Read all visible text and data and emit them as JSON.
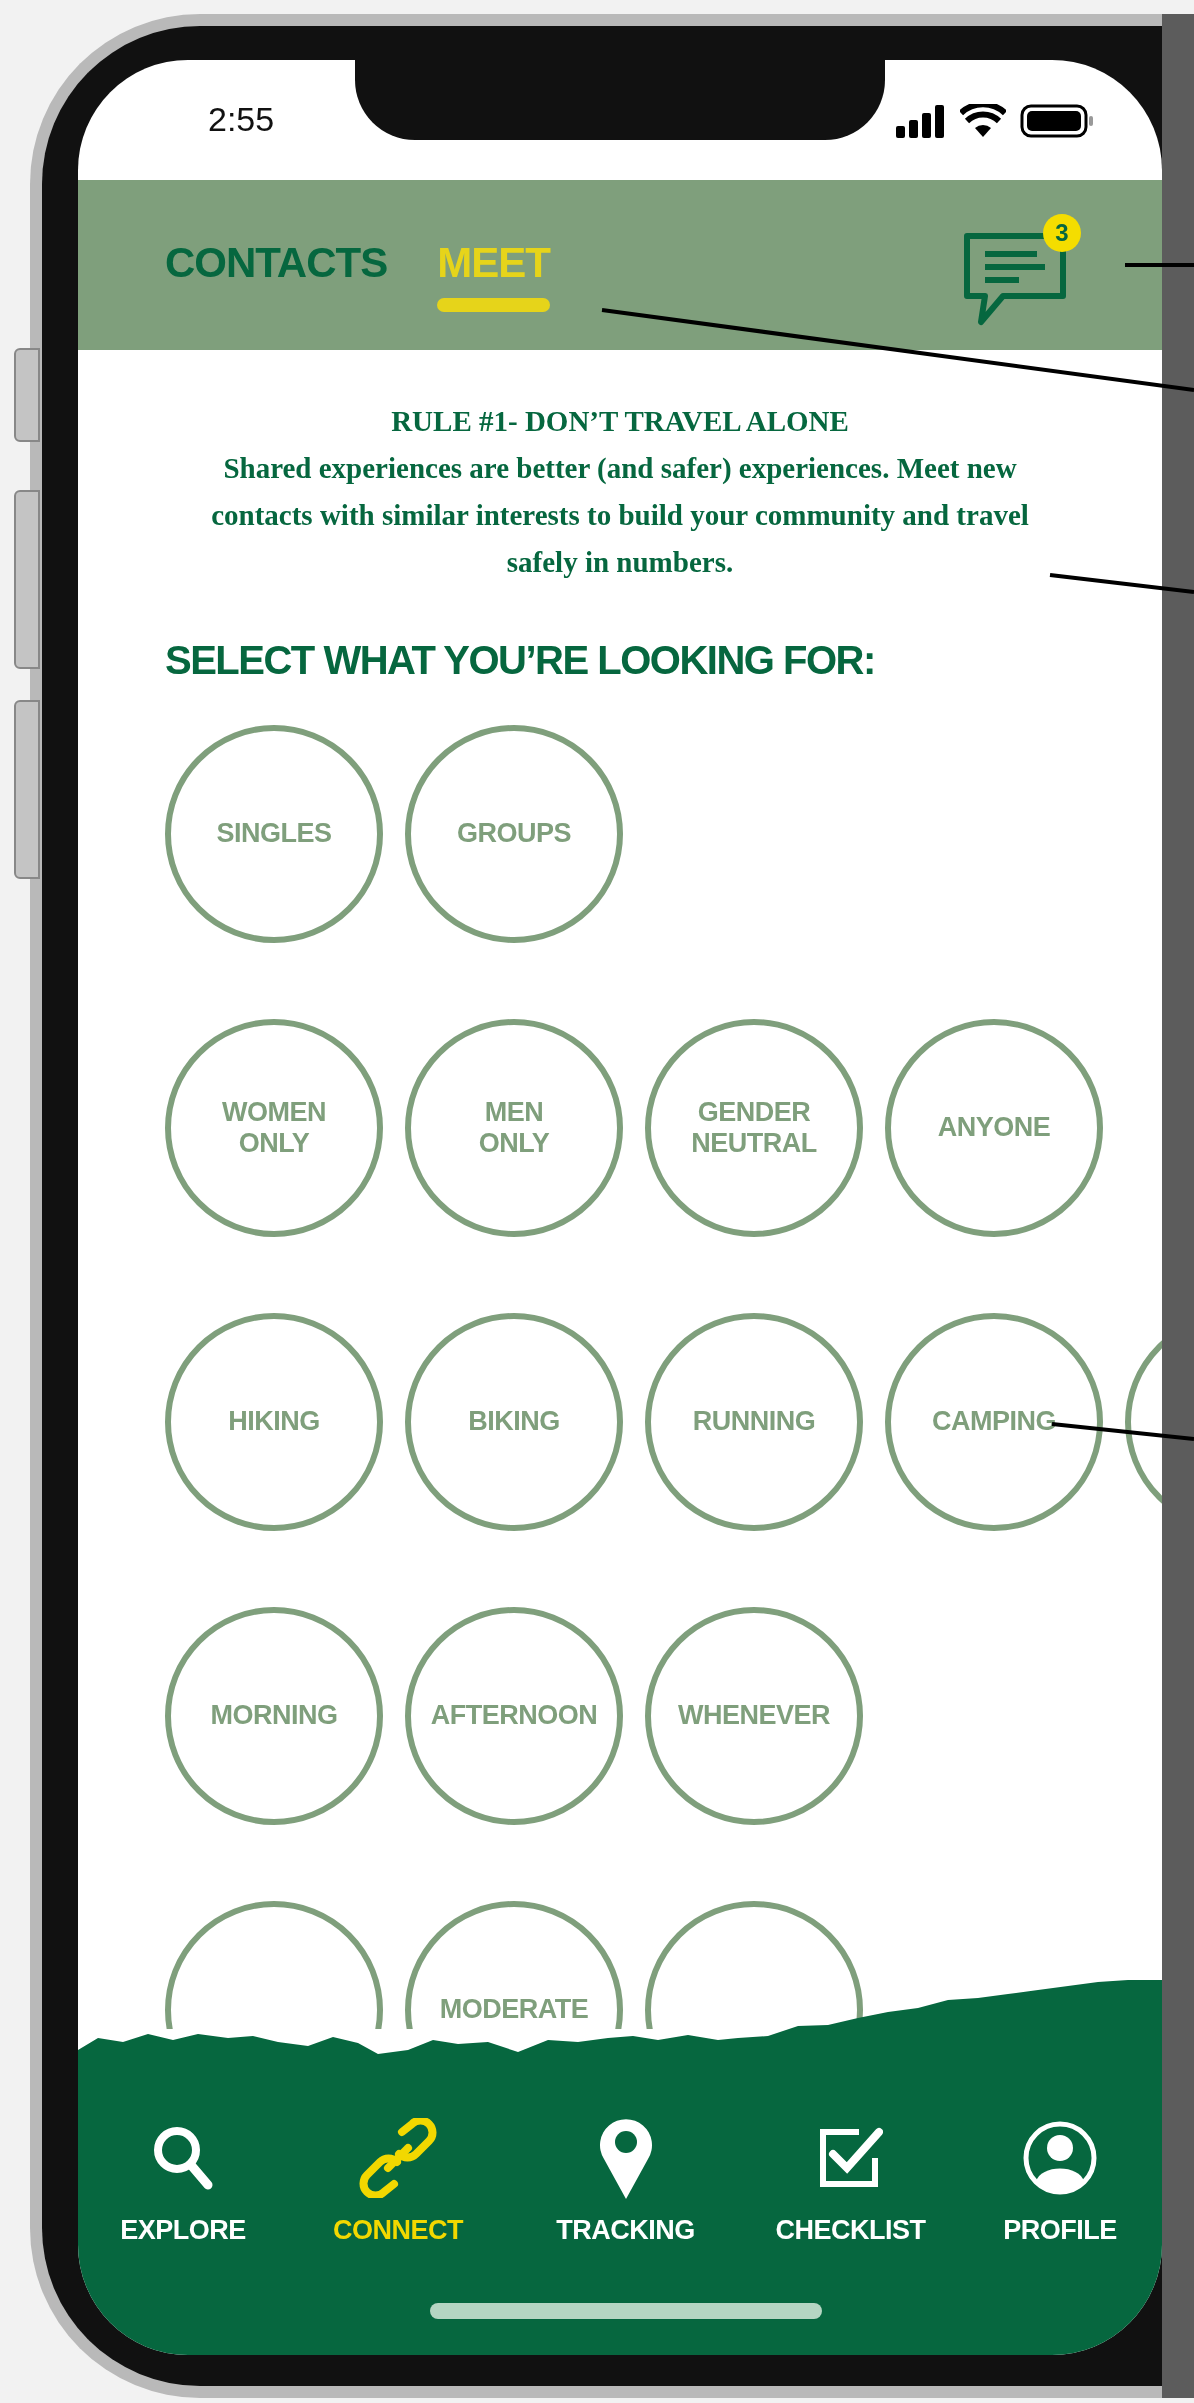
{
  "status_bar": {
    "time": "2:55"
  },
  "tabs": [
    {
      "label": "CONTACTS",
      "selected": false
    },
    {
      "label": "MEET",
      "selected": true
    }
  ],
  "messages": {
    "badge": "3"
  },
  "intro": {
    "title": "RULE #1- DON’T TRAVEL ALONE",
    "text": "Shared experiences are better (and safer) experiences. Meet new contacts with similar interests to build your community and travel safely in numbers."
  },
  "prompt": "SELECT WHAT YOU’RE LOOKING FOR:",
  "option_rows": [
    [
      {
        "label": "SINGLES",
        "selected": false
      },
      {
        "label": "GROUPS",
        "selected": false
      }
    ],
    [
      {
        "label": "WOMEN\nONLY",
        "selected": false
      },
      {
        "label": "MEN\nONLY",
        "selected": false
      },
      {
        "label": "GENDER\nNEUTRAL",
        "selected": false
      },
      {
        "label": "ANYONE",
        "selected": false
      }
    ],
    [
      {
        "label": "HIKING",
        "selected": false
      },
      {
        "label": "BIKING",
        "selected": false
      },
      {
        "label": "RUNNING",
        "selected": false
      },
      {
        "label": "CAMPING",
        "selected": false
      },
      {
        "selected": false
      }
    ],
    [
      {
        "label": "MORNING",
        "selected": false
      },
      {
        "label": "AFTERNOON",
        "selected": false
      },
      {
        "label": "WHENEVER",
        "selected": false
      }
    ],
    [
      {
        "selected": false
      },
      {
        "label": "MODERATE",
        "selected": false
      },
      {
        "selected": false
      }
    ]
  ],
  "nav": [
    {
      "label": "EXPLORE",
      "kind": "search",
      "selected": false
    },
    {
      "label": "CONNECT",
      "kind": "link",
      "selected": true
    },
    {
      "label": "TRACKING",
      "kind": "pin",
      "selected": false
    },
    {
      "label": "CHECKLIST",
      "kind": "checkbox",
      "selected": false
    },
    {
      "label": "PROFILE",
      "kind": "person",
      "selected": false
    }
  ]
}
